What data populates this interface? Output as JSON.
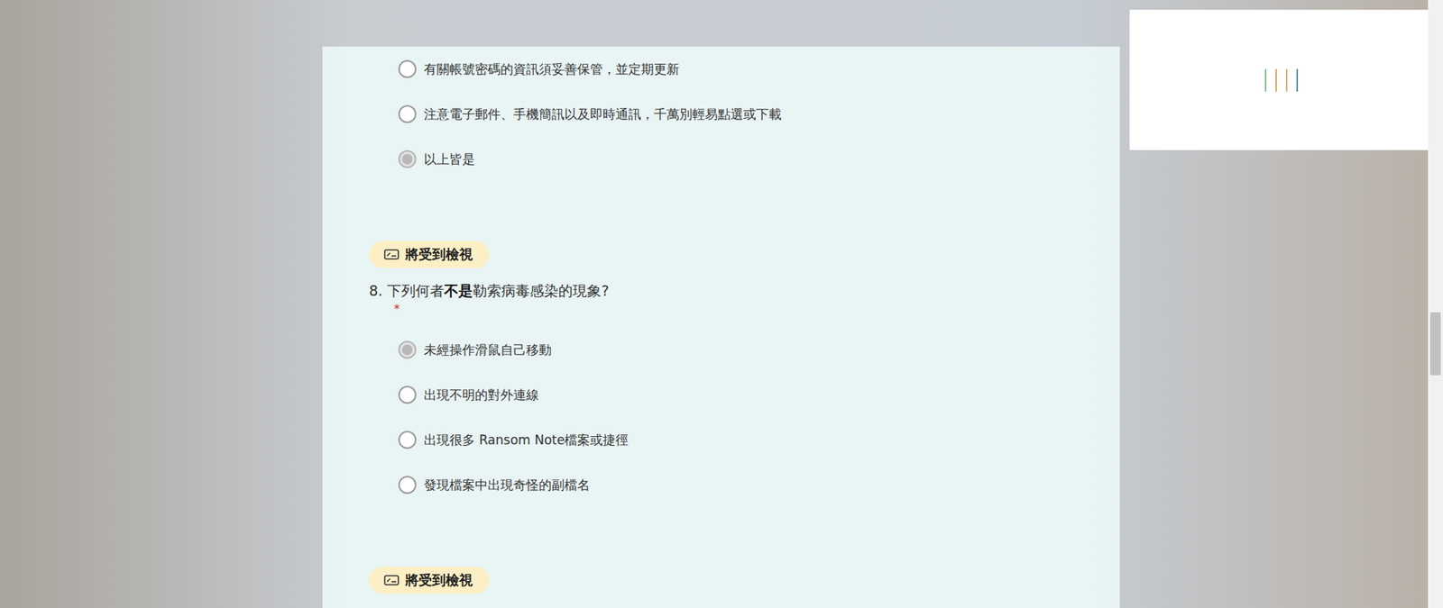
{
  "loading_panel": {
    "busy": true
  },
  "questions": [
    {
      "options": [
        {
          "label": "有關帳號密碼的資訊須妥善保管，並定期更新",
          "selected": false
        },
        {
          "label": "注意電子郵件、手機簡訊以及即時通訊，千萬別輕易點選或下載",
          "selected": false
        },
        {
          "label": "以上皆是",
          "selected": true
        }
      ]
    },
    {
      "badge": "將受到檢視",
      "title_parts": [
        {
          "text": "8. 下列何者",
          "bold": false
        },
        {
          "text": "不是",
          "bold": true
        },
        {
          "text": "勒索病毒感染的現象?",
          "bold": false
        }
      ],
      "required_mark": "*",
      "options": [
        {
          "label": "未經操作滑鼠自己移動",
          "selected": true
        },
        {
          "label": "出現不明的對外連線",
          "selected": false
        },
        {
          "label": "出現很多 Ransom Note檔案或捷徑",
          "selected": false
        },
        {
          "label": "發現檔案中出現奇怪的副檔名",
          "selected": false
        }
      ]
    },
    {
      "badge": "將受到檢視"
    }
  ]
}
